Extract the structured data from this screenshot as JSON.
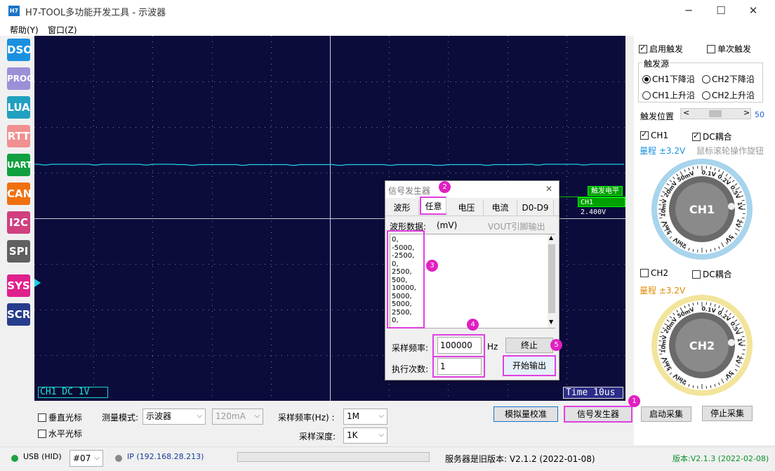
{
  "window": {
    "title": "H7-TOOL多功能开发工具 - 示波器",
    "icon": "H7",
    "minimize": "─",
    "maximize": "☐",
    "close": "✕"
  },
  "menu": [
    "帮助(Y)",
    "窗口(Z)"
  ],
  "toolbar": [
    {
      "label": "DSO",
      "color": "#1a90e0"
    },
    {
      "label": "PROG",
      "color": "#9b8fd8"
    },
    {
      "label": "LUA",
      "color": "#20a0c0"
    },
    {
      "label": "RTT",
      "color": "#f09090"
    },
    {
      "label": "UART",
      "color": "#10a040"
    },
    {
      "label": "CAN",
      "color": "#f07010"
    },
    {
      "label": "I2C",
      "color": "#d04080"
    },
    {
      "label": "SPI",
      "color": "#606060"
    },
    {
      "label": "SYS",
      "color": "#e0208c"
    },
    {
      "label": "SCR",
      "color": "#283c8c"
    }
  ],
  "scope": {
    "ch1_label": "CH1  DC     1V",
    "time_label": "Time  10us",
    "trigger_flag": "触发电平",
    "trigger_value": "CH1 2.400V"
  },
  "trigger": {
    "enable_label": "启用触发",
    "enable_checked": true,
    "single_label": "单次触发",
    "single_checked": false,
    "source_group": "触发源",
    "sources": [
      "CH1下降沿",
      "CH2下降沿",
      "CH1上升沿",
      "CH2上升沿"
    ],
    "selected_source": "CH1下降沿",
    "position_label": "触发位置",
    "position_value": "50"
  },
  "ch1": {
    "label": "CH1",
    "checked": true,
    "dc_label": "DC耦合",
    "dc_checked": true,
    "range": "量程 ±3.2V",
    "hint": "鼠标滚轮操作旋钮",
    "knob_label": "CH1",
    "scale": [
      "0.1V",
      "0.2V",
      "0.5V",
      "1V",
      "2V",
      "5V",
      "2mV",
      "5mV",
      "10mV",
      "20mV",
      "50mV"
    ]
  },
  "ch2": {
    "label": "CH2",
    "checked": false,
    "dc_label": "DC耦合",
    "dc_checked": false,
    "range": "量程 ±3.2V",
    "knob_label": "CH2"
  },
  "bottom": {
    "vcursor_label": "垂直光标",
    "hcursor_label": "水平光标",
    "measure_mode_label": "测量模式:",
    "measure_mode_value": "示波器",
    "current_value": "120mA",
    "sample_rate_label": "采样频率(Hz) :",
    "sample_rate_value": "1M",
    "sample_depth_label": "采样深度:",
    "sample_depth_value": "1K",
    "btn_calibrate": "模拟量校准",
    "btn_siggen": "信号发生器",
    "btn_start": "启动采集",
    "btn_stop": "停止采集"
  },
  "dialog": {
    "title": "信号发生器",
    "close": "✕",
    "tabs": [
      "波形",
      "任意",
      "电压",
      "电流",
      "D0-D9"
    ],
    "active_tab": "任意",
    "data_label": "波形数据:",
    "unit_label": "(mV)",
    "vout_label": "VOUT引脚输出",
    "waveform_data": [
      "0,",
      "-5000,",
      "-2500,",
      "0,",
      "2500,",
      "500,",
      "10000,",
      "5000,",
      "5000,",
      "2500,",
      "0,"
    ],
    "sample_rate_label": "采样频率:",
    "sample_rate_value": "100000",
    "sample_rate_unit": "Hz",
    "exec_count_label": "执行次数:",
    "exec_count_value": "1",
    "btn_stop": "终止",
    "btn_start": "开始输出"
  },
  "badges": [
    "1",
    "2",
    "3",
    "4",
    "5"
  ],
  "status": {
    "usb": "USB (HID)",
    "device": "#07",
    "ip": "IP (192.168.28.213)",
    "server": "服务器是旧版本: V2.1.2 (2022-01-08)",
    "version": "版本:V2.1.3 (2022-02-08)"
  },
  "colors": {
    "scope_bg": "#0c0c3c",
    "trace": "#20d0e0",
    "highlight": "#e040e0",
    "ch1_range": "#1a90e0",
    "ch2_range": "#e08a00",
    "version": "#109030"
  }
}
